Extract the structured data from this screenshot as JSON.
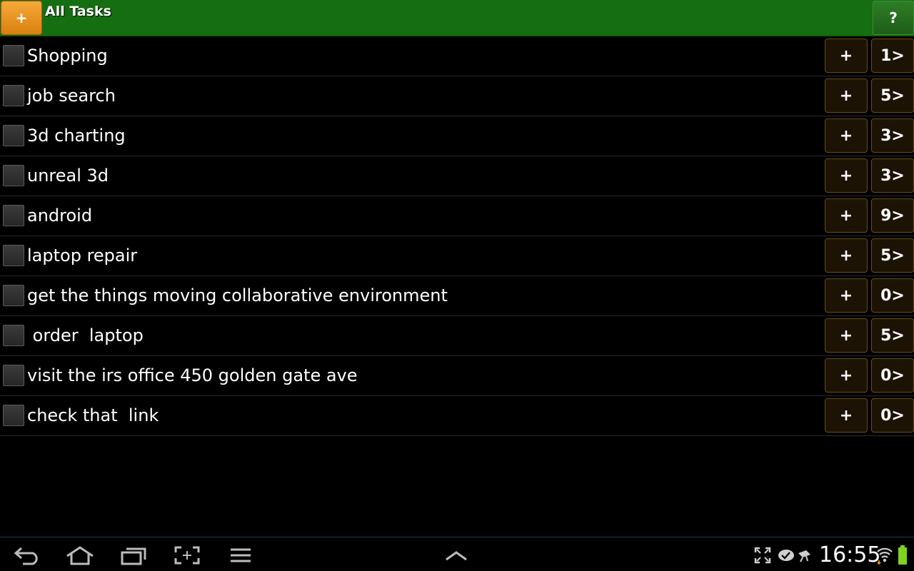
{
  "header": {
    "title": "All Tasks",
    "add_label": "+",
    "help_label": "?",
    "bg_color": "#156e0f"
  },
  "tasks": [
    {
      "label": "Shopping",
      "add_label": "+",
      "count_label": "1>"
    },
    {
      "label": "job search",
      "add_label": "+",
      "count_label": "5>"
    },
    {
      "label": "3d charting",
      "add_label": "+",
      "count_label": "3>"
    },
    {
      "label": "unreal 3d",
      "add_label": "+",
      "count_label": "3>"
    },
    {
      "label": "android",
      "add_label": "+",
      "count_label": "9>"
    },
    {
      "label": "laptop repair",
      "add_label": "+",
      "count_label": "5>"
    },
    {
      "label": "get the things moving collaborative environment",
      "add_label": "+",
      "count_label": "0>"
    },
    {
      "label": " order  laptop",
      "add_label": "+",
      "count_label": "5>"
    },
    {
      "label": "visit the irs office 450 golden gate ave",
      "add_label": "+",
      "count_label": "0>"
    },
    {
      "label": "check that  link",
      "add_label": "+",
      "count_label": "0>"
    }
  ],
  "navbar": {
    "icons": [
      "back-icon",
      "home-icon",
      "recent-apps-icon",
      "screenshot-icon",
      "menu-icon",
      "chevron-up-icon"
    ],
    "status_icons": [
      "fullscreen-icon",
      "sync-icon",
      "usb-icon",
      "wifi-icon",
      "battery-icon"
    ],
    "time": "16:55"
  },
  "colors": {
    "accent_orange": "#e08a17",
    "button_border": "#6b4a16",
    "battery_green": "#7ed321"
  }
}
